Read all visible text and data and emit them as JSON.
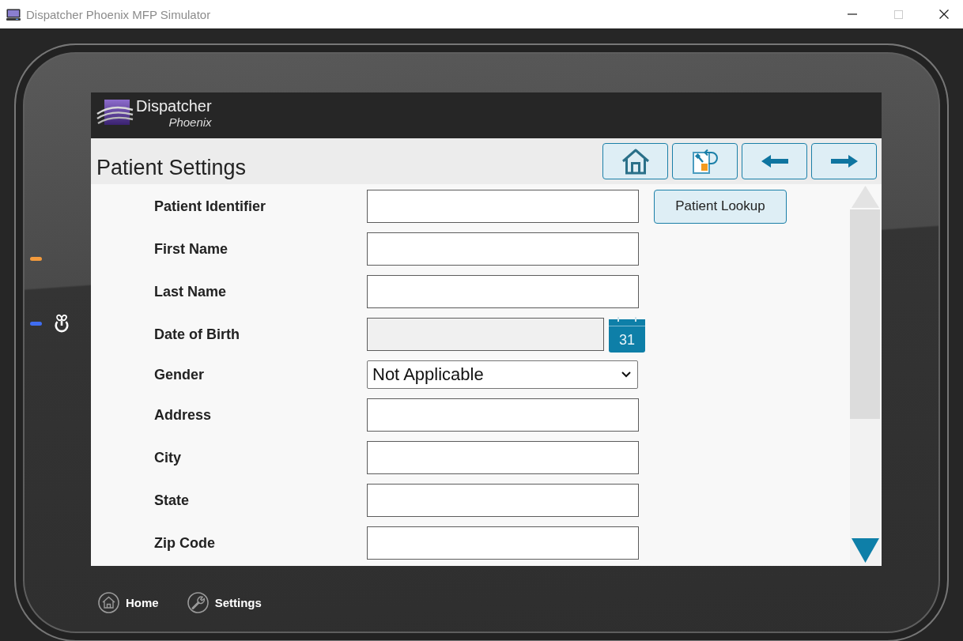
{
  "window": {
    "title": "Dispatcher Phoenix MFP Simulator",
    "controls": [
      {
        "kind": "minimize",
        "disabled": false
      },
      {
        "kind": "maximize",
        "disabled": true
      },
      {
        "kind": "close",
        "disabled": false
      }
    ]
  },
  "device": {
    "indicators": [
      {
        "kind": "led",
        "color": "#f39a3c"
      },
      {
        "kind": "power",
        "color": "#3f6df2"
      }
    ]
  },
  "app_header": {
    "logo_title": "Dispatcher",
    "logo_subtitle": "Phoenix"
  },
  "page": {
    "title": "Patient Settings",
    "toolbar": [
      {
        "kind": "home"
      },
      {
        "kind": "document"
      },
      {
        "kind": "back"
      },
      {
        "kind": "forward"
      }
    ]
  },
  "form": {
    "fields": [
      {
        "label": "Patient Identifier",
        "kind": "text",
        "disabled": false,
        "button": "Patient Lookup"
      },
      {
        "label": "First Name",
        "kind": "text",
        "disabled": false
      },
      {
        "label": "Last Name",
        "kind": "text",
        "disabled": false
      },
      {
        "label": "Date of Birth",
        "kind": "date",
        "disabled": true,
        "button": "31"
      },
      {
        "label": "Gender",
        "kind": "select",
        "disabled": false,
        "value": "Not Applicable"
      },
      {
        "label": "Address",
        "kind": "text",
        "disabled": false
      },
      {
        "label": "City",
        "kind": "text",
        "disabled": false
      },
      {
        "label": "State",
        "kind": "text",
        "disabled": false
      },
      {
        "label": "Zip Code",
        "kind": "text",
        "disabled": false
      }
    ]
  },
  "bottom_nav": [
    {
      "kind": "home",
      "label": "Home"
    },
    {
      "kind": "settings",
      "label": "Settings"
    }
  ]
}
